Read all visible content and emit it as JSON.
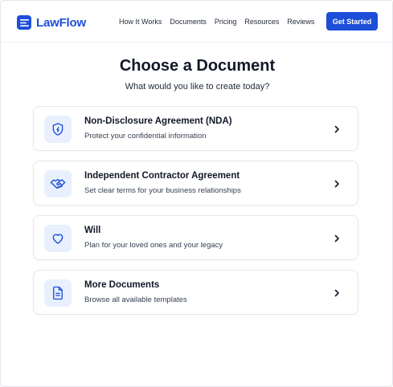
{
  "header": {
    "brand": "LawFlow",
    "nav": [
      "How It Works",
      "Documents",
      "Pricing",
      "Resources",
      "Reviews"
    ],
    "cta_label": "Get Started"
  },
  "main": {
    "title": "Choose a Document",
    "subtitle": "What would you like to create today?",
    "cards": [
      {
        "icon": "shield-icon",
        "title": "Non-Disclosure Agreement (NDA)",
        "description": "Protect your confidential information"
      },
      {
        "icon": "handshake-icon",
        "title": "Independent Contractor Agreement",
        "description": "Set clear terms for your business relationships"
      },
      {
        "icon": "heart-icon",
        "title": "Will",
        "description": "Plan for your loved ones and your legacy"
      },
      {
        "icon": "document-icon",
        "title": "More Documents",
        "description": "Browse all available templates"
      }
    ]
  },
  "colors": {
    "brand": "#1d4ed8",
    "icon_bg": "#e8f0fe",
    "border": "#e5e7eb"
  }
}
